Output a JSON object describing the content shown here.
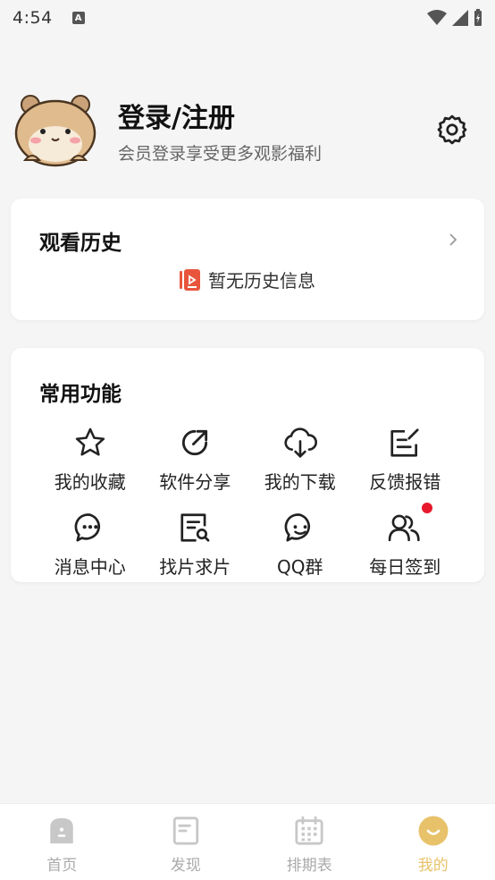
{
  "status_bar": {
    "time": "4:54",
    "notification_badge": "A"
  },
  "profile": {
    "title": "登录/注册",
    "subtitle": "会员登录享受更多观影福利"
  },
  "history": {
    "title": "观看历史",
    "empty_text": "暂无历史信息"
  },
  "functions": {
    "title": "常用功能",
    "items": [
      {
        "label": "我的收藏",
        "icon": "star-icon"
      },
      {
        "label": "软件分享",
        "icon": "share-icon"
      },
      {
        "label": "我的下载",
        "icon": "cloud-download-icon"
      },
      {
        "label": "反馈报错",
        "icon": "feedback-icon"
      },
      {
        "label": "消息中心",
        "icon": "message-icon"
      },
      {
        "label": "找片求片",
        "icon": "search-doc-icon"
      },
      {
        "label": "QQ群",
        "icon": "chat-group-icon"
      },
      {
        "label": "每日签到",
        "icon": "users-icon"
      }
    ]
  },
  "bottom_nav": {
    "items": [
      {
        "label": "首页",
        "icon": "home-icon"
      },
      {
        "label": "发现",
        "icon": "discover-icon"
      },
      {
        "label": "排期表",
        "icon": "calendar-icon"
      },
      {
        "label": "我的",
        "icon": "profile-smile-icon",
        "active": true
      }
    ]
  },
  "colors": {
    "accent": "#e8c26a",
    "badge": "#e8192c",
    "history_icon": "#e8553c"
  }
}
